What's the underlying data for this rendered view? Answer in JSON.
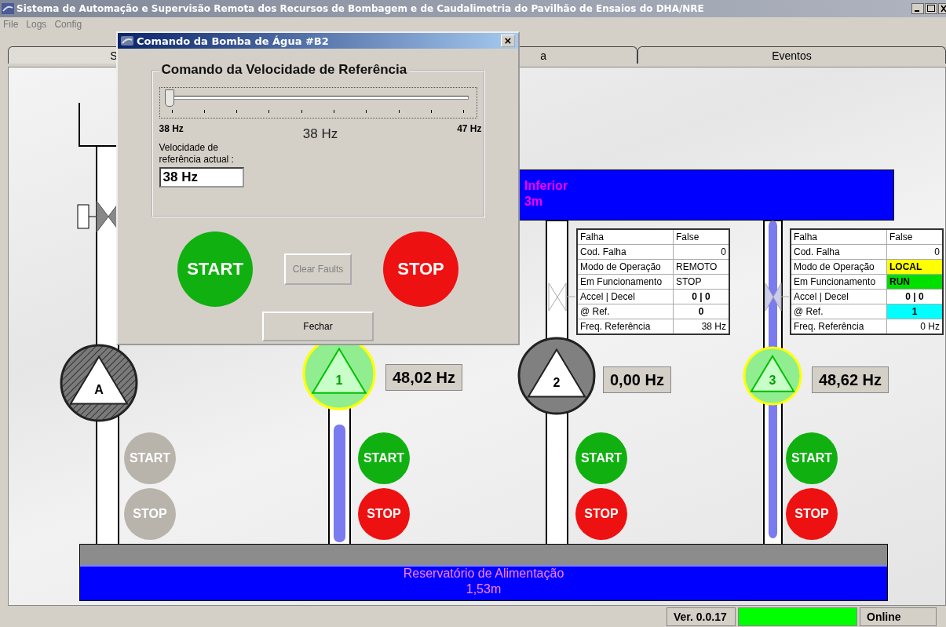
{
  "window": {
    "title": "Sistema de Automação e Supervisão Remota dos Recursos de Bombagem e de Caudalimetria do Pavilhão de Ensaios do DHA/NRE"
  },
  "menu": [
    "File",
    "Logs",
    "Config"
  ],
  "tabs": [
    {
      "label": "S",
      "selected": true
    },
    {
      "label": "a",
      "selected": false
    },
    {
      "label": "Eventos",
      "selected": false
    }
  ],
  "upper_reservoir": {
    "name": "Inferior",
    "level_text": "3m"
  },
  "lower_reservoir": {
    "name": "Reservatório de Alimentação",
    "level_text": "1,53m"
  },
  "pumps": [
    {
      "id": "A",
      "available": false,
      "running": false,
      "start": "START",
      "stop": "STOP",
      "controls_disabled": true
    },
    {
      "id": "1",
      "available": true,
      "running": true,
      "frequency": "48,02 Hz",
      "start": "START",
      "stop": "STOP",
      "controls_disabled": false
    },
    {
      "id": "2",
      "available": true,
      "running": false,
      "frequency": "0,00 Hz",
      "start": "START",
      "stop": "STOP",
      "controls_disabled": false
    },
    {
      "id": "3",
      "available": true,
      "running": true,
      "frequency": "48,62 Hz",
      "start": "START",
      "stop": "STOP",
      "controls_disabled": false
    }
  ],
  "info_tables": [
    {
      "rows": [
        {
          "label": "Falha",
          "value": "False"
        },
        {
          "label": "Cod. Falha",
          "value": "0"
        },
        {
          "label": "Modo de Operação",
          "value": "REMOTO"
        },
        {
          "label": "Em Funcionamento",
          "value": "STOP"
        },
        {
          "label": "Accel | Decel",
          "value": "0 | 0"
        },
        {
          "label": "@ Ref.",
          "value": "0"
        },
        {
          "label": "Freq. Referência",
          "value": "38 Hz"
        }
      ]
    },
    {
      "rows": [
        {
          "label": "Falha",
          "value": "False"
        },
        {
          "label": "Cod. Falha",
          "value": "0"
        },
        {
          "label": "Modo de Operação",
          "value": "LOCAL",
          "color": "#ffff00"
        },
        {
          "label": "Em Funcionamento",
          "value": "RUN",
          "color": "#00e000"
        },
        {
          "label": "Accel | Decel",
          "value": "0 | 0"
        },
        {
          "label": "@ Ref.",
          "value": "1",
          "color": "#00ffff"
        },
        {
          "label": "Freq. Referência",
          "value": "0 Hz"
        }
      ]
    }
  ],
  "dialog": {
    "title": "Comando da Bomba de Água #B2",
    "close": "×",
    "group_title": "Comando da Velocidade de Referência",
    "slider": {
      "level": 0,
      "min_label": "38 Hz",
      "max_label": "47 Hz",
      "value_label": "38 Hz"
    },
    "current_label": "Velocidade de referência actual :",
    "current_value": "38 Hz",
    "start": "START",
    "clear_faults": {
      "label": "Clear Faults",
      "disabled": true
    },
    "stop": "STOP",
    "close_button": "Fechar"
  },
  "status_bar": {
    "version": "Ver. 0.0.17",
    "online": true,
    "connection": "Online"
  }
}
